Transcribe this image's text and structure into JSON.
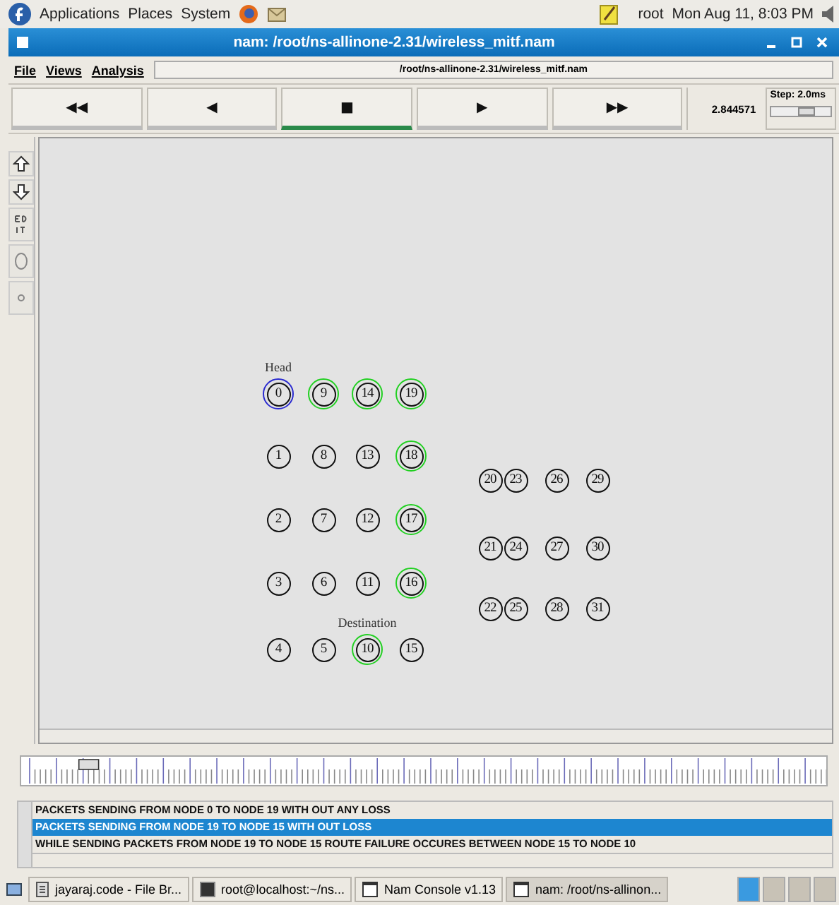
{
  "top_panel": {
    "menus": [
      "Applications",
      "Places",
      "System"
    ],
    "user": "root",
    "clock": "Mon Aug 11,  8:03 PM"
  },
  "window": {
    "title": "nam: /root/ns-allinone-2.31/wireless_mitf.nam"
  },
  "menu_bar": {
    "items": [
      "File",
      "Views",
      "Analysis"
    ],
    "file_path": "/root/ns-allinone-2.31/wireless_mitf.nam"
  },
  "transport": {
    "buttons": [
      {
        "symbol": "◀◀",
        "selected": false
      },
      {
        "symbol": "◀",
        "selected": false
      },
      {
        "symbol": "■",
        "selected": true
      },
      {
        "symbol": "▶",
        "selected": false
      },
      {
        "symbol": "▶▶",
        "selected": false
      }
    ],
    "time": "2.844571",
    "step": "Step: 2.0ms",
    "step_slider": {
      "level": 0.6
    }
  },
  "node_rows": [
    {
      "nodes": [
        {
          "label": "0",
          "color": "#2a2ad0",
          "caption": "Head"
        },
        {
          "label": "9",
          "color": "#22d022"
        },
        {
          "label": "14",
          "color": "#22d022"
        },
        {
          "label": "19",
          "color": "#22d022"
        }
      ]
    },
    {
      "nodes": [
        {
          "label": "1"
        },
        {
          "label": "8"
        },
        {
          "label": "13"
        },
        {
          "label": "18",
          "color": "#22d022"
        }
      ]
    },
    {
      "nodes": [
        {
          "label": "20"
        },
        {
          "label": "23"
        },
        {
          "label": "26"
        },
        {
          "label": "29"
        }
      ]
    },
    {
      "nodes": [
        {
          "label": "2"
        },
        {
          "label": "7"
        },
        {
          "label": "12"
        },
        {
          "label": "17",
          "color": "#22d022"
        }
      ]
    },
    {
      "nodes": [
        {
          "label": "21"
        },
        {
          "label": "24"
        },
        {
          "label": "27"
        },
        {
          "label": "30"
        }
      ]
    },
    {
      "nodes": [
        {
          "label": "3"
        },
        {
          "label": "6"
        },
        {
          "label": "11"
        },
        {
          "label": "16",
          "color": "#22d022"
        }
      ]
    },
    {
      "nodes": [
        {
          "label": "22"
        },
        {
          "label": "25"
        },
        {
          "label": "28"
        },
        {
          "label": "31"
        }
      ]
    },
    {
      "nodes": [
        {
          "label": "4"
        },
        {
          "label": "5"
        },
        {
          "label": "10",
          "color": "#22d022",
          "caption": "Destination"
        },
        {
          "label": "15"
        }
      ]
    }
  ],
  "annotations": [
    {
      "text": "PACKETS SENDING FROM NODE 0 TO NODE 19 WITH OUT ANY LOSS",
      "selected": false
    },
    {
      "text": "PACKETS SENDING FROM NODE 19 TO NODE 15 WITH OUT LOSS",
      "selected": true
    },
    {
      "text": "WHILE SENDING PACKETS FROM NODE 19 TO NODE 15 ROUTE FAILURE OCCURES BETWEEN NODE 15 TO NODE 10",
      "selected": false
    }
  ],
  "taskbar": {
    "items": [
      {
        "label": "jayaraj.code - File Br...",
        "kind": "files",
        "selected": false
      },
      {
        "label": "root@localhost:~/ns...",
        "kind": "terminal",
        "selected": false
      },
      {
        "label": "Nam Console v1.13",
        "kind": "window",
        "selected": false
      },
      {
        "label": "nam: /root/ns-allinon...",
        "kind": "window",
        "selected": true
      }
    ]
  }
}
